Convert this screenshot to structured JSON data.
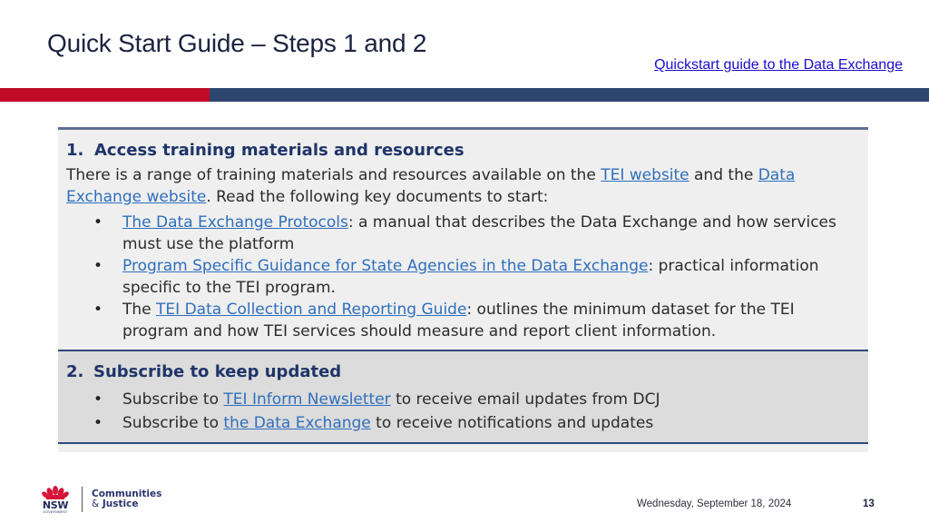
{
  "slide": {
    "title": "Quick Start Guide – Steps 1 and 2",
    "top_link": "Quickstart guide to the Data Exchange",
    "colors": {
      "accent_red": "#c10b27",
      "accent_navy": "#2d4670",
      "link_blue": "#2f6fbd",
      "heading_navy": "#1f3468"
    }
  },
  "step1": {
    "number": "1.",
    "heading": "Access training materials and resources",
    "intro": {
      "part1": "There is a range of training materials and resources available on the ",
      "link1": "TEI website",
      "part2": " and the ",
      "link2": "Data Exchange website",
      "part3": ". Read the following key documents to start:"
    },
    "bullets": [
      {
        "prefix": "",
        "link": "The Data Exchange Protocols",
        "suffix": ": a manual that describes the Data Exchange and how services must use the platform"
      },
      {
        "prefix": "",
        "link": "Program Specific Guidance for State Agencies in the Data Exchange",
        "suffix": ": practical information specific to the TEI program."
      },
      {
        "prefix": "The ",
        "link": "TEI Data Collection and Reporting Guide",
        "suffix": ": outlines the minimum dataset for the TEI program and how TEI services should measure and report client information."
      }
    ]
  },
  "step2": {
    "number": "2.",
    "heading": "Subscribe to keep updated",
    "bullets": [
      {
        "prefix": "Subscribe to ",
        "link": "TEI Inform Newsletter",
        "suffix": " to receive email updates from DCJ"
      },
      {
        "prefix": "Subscribe to ",
        "link": "the Data Exchange",
        "suffix": " to receive notifications and updates"
      }
    ]
  },
  "footer": {
    "logo_nsw": "NSW",
    "logo_government": "GOVERNMENT",
    "logo_line1": "Communities",
    "logo_amp": "&",
    "logo_line2": "Justice",
    "date": "Wednesday, September 18, 2024",
    "page_number": "13",
    "bullet_glyph": "•"
  }
}
